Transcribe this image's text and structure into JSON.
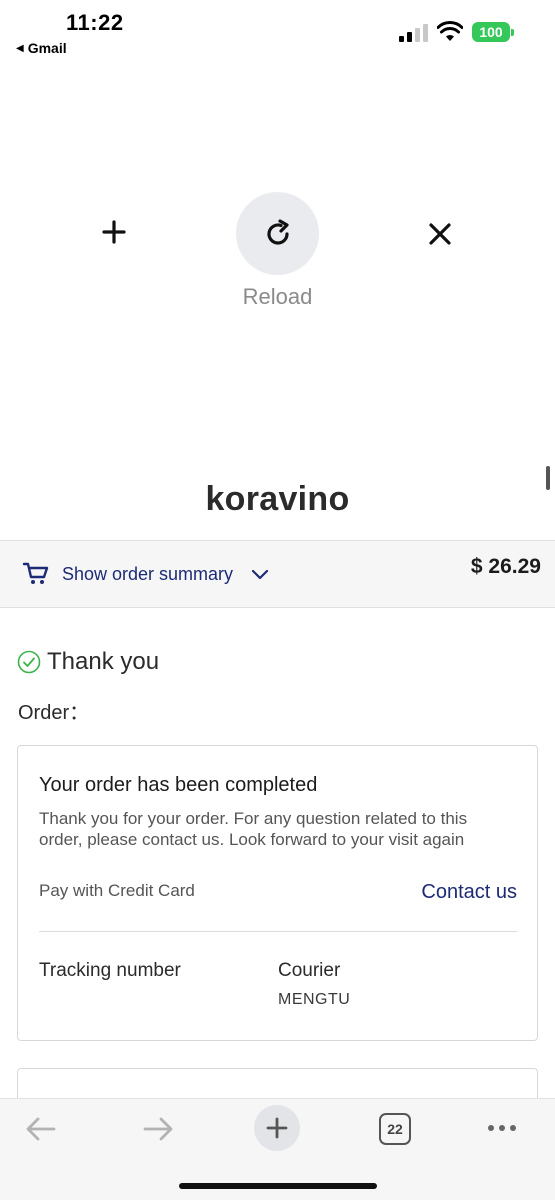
{
  "status_bar": {
    "time": "11:22",
    "back_app": "Gmail",
    "battery": "100",
    "battery_color": "#34c759"
  },
  "pull_refresh": {
    "reload_label": "Reload",
    "icons": [
      "plus-icon",
      "reload-icon",
      "close-icon"
    ]
  },
  "page": {
    "brand": "koravino",
    "summary": {
      "toggle_label": "Show order summary",
      "total": "$ 26.29"
    },
    "thanks": "Thank you",
    "order_label": "Order：",
    "completed_card": {
      "title": "Your order has been completed",
      "message": "Thank you for your order. For any question related to this order, please contact us. Look forward to your visit again",
      "payment": "Pay with Credit Card",
      "contact": "Contact us",
      "tracking_label": "Tracking number",
      "courier_label": "Courier",
      "courier_value": "MENGTU"
    }
  },
  "toolbar": {
    "tab_count": "22",
    "icons": [
      "back-arrow-icon",
      "forward-arrow-icon",
      "new-tab-icon",
      "tabs-icon",
      "more-icon"
    ]
  },
  "colors": {
    "accent_navy": "#1d2b76",
    "success_green": "#3bb34a"
  }
}
